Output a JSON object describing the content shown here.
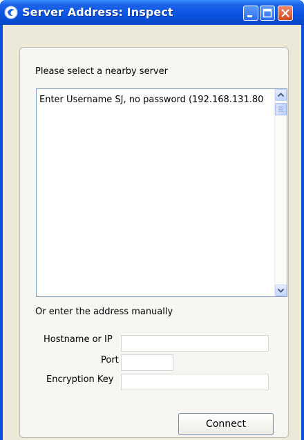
{
  "window": {
    "title": "Server Address: Inspect",
    "colors": {
      "titlebar": "#0b54e0",
      "close_button": "#d2471e",
      "client": "#ece9d8"
    }
  },
  "titlebar_buttons": {
    "minimize_icon": "minimize-icon",
    "maximize_icon": "maximize-icon",
    "close_icon": "close-icon"
  },
  "server_select": {
    "label": "Please select a nearby server",
    "items": [
      {
        "text": "Enter Username SJ, no password (192.168.131.80"
      }
    ]
  },
  "manual": {
    "label": "Or enter the address manually",
    "hostname_label": "Hostname or IP",
    "hostname_value": "",
    "port_label": "Port",
    "port_value": "",
    "key_label": "Encryption Key",
    "key_value": ""
  },
  "connect_button": "Connect"
}
